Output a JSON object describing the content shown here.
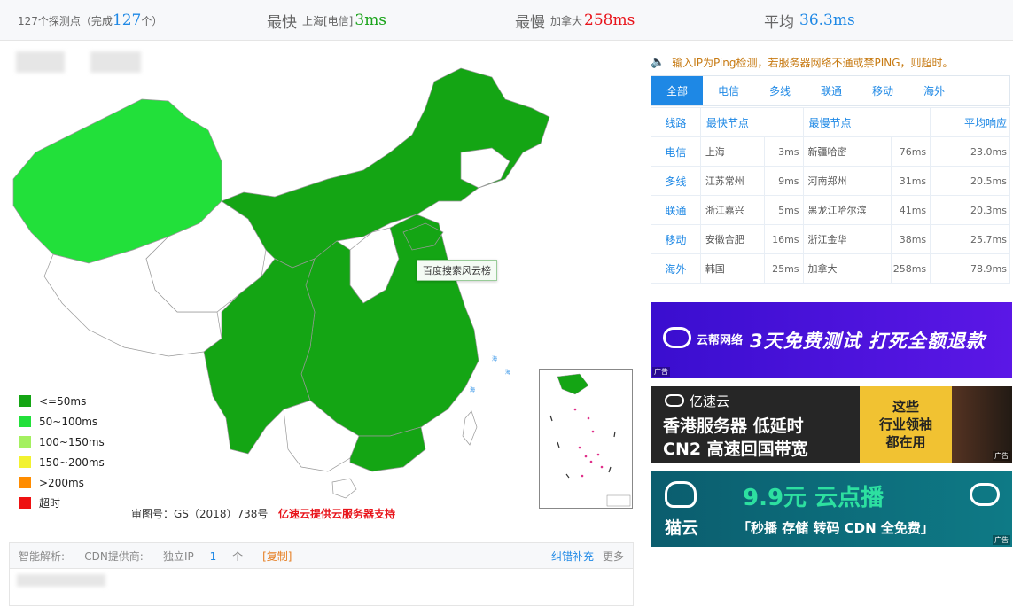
{
  "summary": {
    "points_prefix": "127个探测点（完成",
    "points_done": "127",
    "points_suffix": "个）",
    "fastest_label": "最快",
    "fastest_node": "上海[电信]",
    "fastest_value": "3ms",
    "slowest_label": "最慢",
    "slowest_node": "加拿大",
    "slowest_value": "258ms",
    "average_label": "平均",
    "average_value": "36.3ms"
  },
  "map": {
    "tooltip": "百度搜索风云榜",
    "approval": "审图号：GS（2018）738号",
    "sponsor": "亿速云提供云服务器支持",
    "legend": [
      {
        "label": "<=50ms",
        "color": "#14a514"
      },
      {
        "label": "50~100ms",
        "color": "#22e03a"
      },
      {
        "label": "100~150ms",
        "color": "#a4f060"
      },
      {
        "label": "150~200ms",
        "color": "#f2f230"
      },
      {
        "label": ">200ms",
        "color": "#ff8c00"
      },
      {
        "label": "超时",
        "color": "#ee1111"
      }
    ],
    "colors": {
      "fast": "#14a514",
      "medium": "#22e03a",
      "none": "#ffffff"
    }
  },
  "info": {
    "dns_label": "智能解析: -",
    "cdn_label": "CDN提供商: -",
    "ip_label": "独立IP",
    "ip_count": "1",
    "ip_unit": "个",
    "copy_label": "[复制]",
    "report_label": "纠错补充",
    "more_label": "更多"
  },
  "notice": "输入IP为Ping检测，若服务器网络不通或禁PING，则超时。",
  "tabs": [
    "全部",
    "电信",
    "多线",
    "联通",
    "移动",
    "海外"
  ],
  "table": {
    "headers": [
      "线路",
      "最快节点",
      "最慢节点",
      "平均响应"
    ],
    "rows": [
      {
        "isp": "电信",
        "fast": "上海",
        "fast_ms": "3ms",
        "slow": "新疆哈密",
        "slow_ms": "76ms",
        "avg": "23.0ms"
      },
      {
        "isp": "多线",
        "fast": "江苏常州",
        "fast_ms": "9ms",
        "slow": "河南郑州",
        "slow_ms": "31ms",
        "avg": "20.5ms"
      },
      {
        "isp": "联通",
        "fast": "浙江嘉兴",
        "fast_ms": "5ms",
        "slow": "黑龙江哈尔滨",
        "slow_ms": "41ms",
        "avg": "20.3ms"
      },
      {
        "isp": "移动",
        "fast": "安徽合肥",
        "fast_ms": "16ms",
        "slow": "浙江金华",
        "slow_ms": "38ms",
        "avg": "25.7ms"
      },
      {
        "isp": "海外",
        "fast": "韩国",
        "fast_ms": "25ms",
        "slow": "加拿大",
        "slow_ms": "258ms",
        "avg": "78.9ms"
      }
    ]
  },
  "ads": [
    {
      "brand": "云帮网络",
      "slogan": "3天免费测试 打死全额退款",
      "tag": "广告"
    },
    {
      "brand": "亿速云",
      "line1": "香港服务器 低延时",
      "line2": "CN2 高速回国带宽",
      "side1": "这些",
      "side2": "行业领袖",
      "side3": "都在用",
      "tag": "广告"
    },
    {
      "brand": "猫云",
      "headline": "9.9元 云点播",
      "sub": "「秒播 存储 转码 CDN 全免费」",
      "tag": "广告"
    }
  ]
}
